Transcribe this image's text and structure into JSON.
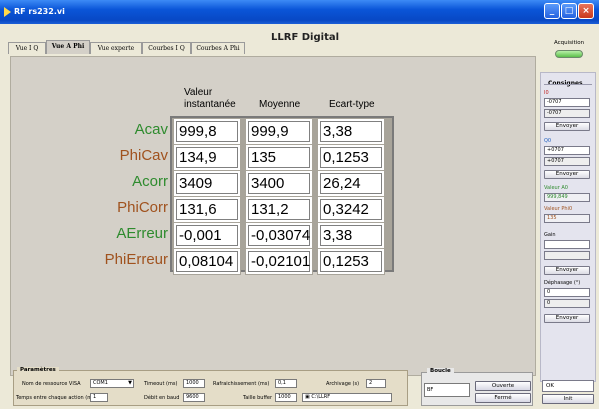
{
  "window": {
    "title": "RF rs232.vi",
    "minimize": "_",
    "maximize": "□",
    "close": "×"
  },
  "tabs": [
    "Vue I Q",
    "Vue A Phi",
    "Vue experte",
    "Courbes I Q",
    "Courbes A Phi"
  ],
  "page_title": "LLRF Digital",
  "table": {
    "headers": [
      "Valeur\ninstantanée",
      "Moyenne",
      "Ecart-type"
    ],
    "rows": [
      {
        "label": "Acav",
        "color": "#2e8b2e",
        "values": [
          "999,8",
          "999,9",
          "3,38"
        ]
      },
      {
        "label": "PhiCav",
        "color": "#a0521e",
        "values": [
          "134,9",
          "135",
          "0,1253"
        ]
      },
      {
        "label": "Acorr",
        "color": "#2e8b2e",
        "values": [
          "3409",
          "3400",
          "26,24"
        ]
      },
      {
        "label": "PhiCorr",
        "color": "#a0521e",
        "values": [
          "131,6",
          "131,2",
          "0,3242"
        ]
      },
      {
        "label": "AErreur",
        "color": "#2e8b2e",
        "values": [
          "-0,001",
          "-0,03074",
          "3,38"
        ]
      },
      {
        "label": "PhiErreur",
        "color": "#a0521e",
        "values": [
          "0,08104",
          "-0,02101",
          "0,1253"
        ]
      }
    ]
  },
  "acquisition": {
    "label": "Acquisition"
  },
  "consignes": {
    "title": "Consignes",
    "i0_label": "I0",
    "i0_value": "-0707",
    "i0_readback": "-0707",
    "q0_label": "Q0",
    "q0_value": "+0707",
    "q0_readback": "+0707",
    "send": "Envoyer",
    "valeur_a0_label": "Valeur A0",
    "valeur_a0_value": "999,849",
    "valeur_phi0_label": "Valeur Phi0",
    "valeur_phi0_value": "135",
    "gain_label": "Gain",
    "gain_value": "",
    "gain_readback": "",
    "dephasage_label": "Déphasage (°)",
    "dephasage_value": "0",
    "dephasage_readback": "0"
  },
  "parametres": {
    "title": "Paramètres",
    "visa_label": "Nom de ressource VISA",
    "visa_value": "COM1",
    "timeout_label": "Timeout (ms)",
    "timeout_value": "1000",
    "refresh_label": "Rafraichissement (ms)",
    "refresh_value": "0,1",
    "archive_label": "Archivage (s)",
    "archive_value": "2",
    "delay_label": "Temps entre chaque action (ms)",
    "delay_value": "1",
    "baud_label": "Débit en baud",
    "baud_value": "9600",
    "buffer_label": "Taille buffer",
    "buffer_value": "1000",
    "path_value": "C:\\LLRF"
  },
  "boucle": {
    "title": "Boucle",
    "status": "BF",
    "open": "Ouverte",
    "closed": "Fermé"
  },
  "ok": {
    "field": "OK",
    "init": "Init"
  }
}
